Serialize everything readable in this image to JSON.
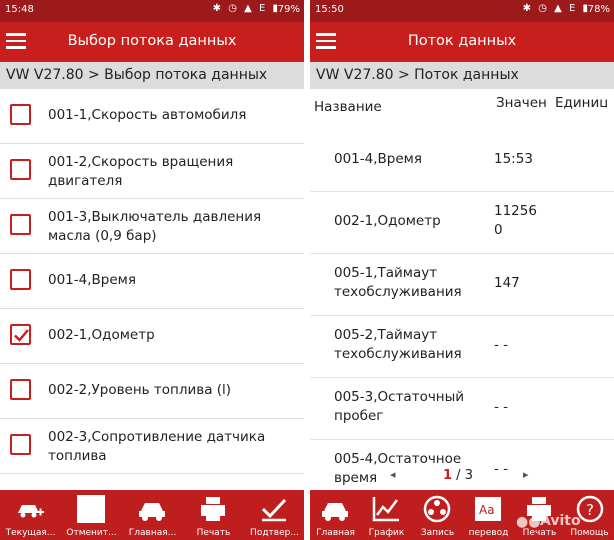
{
  "left": {
    "status": {
      "time": "15:48",
      "battery": "79%",
      "network": "E"
    },
    "appbar": {
      "title": "Выбор потока данных"
    },
    "breadcrumb": "VW V27.80 > Выбор потока данных",
    "items": [
      {
        "label": "001-1,Скорость автомобиля",
        "checked": false
      },
      {
        "label": "001-2,Скорость вращения двигателя",
        "checked": false
      },
      {
        "label": "001-3,Выключатель давления масла (0,9 бар)",
        "checked": false
      },
      {
        "label": "001-4,Время",
        "checked": false
      },
      {
        "label": "002-1,Одометр",
        "checked": true
      },
      {
        "label": "002-2,Уровень топлива (l)",
        "checked": false
      },
      {
        "label": "002-3,Сопротивление датчика топлива",
        "checked": false
      }
    ],
    "bottom": [
      {
        "label": "Текущая...",
        "icon": "car-plus-icon"
      },
      {
        "label": "Отменит...",
        "icon": "checkbox-icon"
      },
      {
        "label": "Главная...",
        "icon": "car-icon"
      },
      {
        "label": "Печать",
        "icon": "printer-icon"
      },
      {
        "label": "Подтвер...",
        "icon": "check-icon"
      }
    ]
  },
  "right": {
    "status": {
      "time": "15:50",
      "battery": "78%",
      "network": "E"
    },
    "appbar": {
      "title": "Поток данных"
    },
    "breadcrumb": "VW V27.80 > Поток данных",
    "columns": {
      "name": "Название",
      "value": "Значение",
      "unit": "Единица"
    },
    "rows": [
      {
        "name": "001-4,Время",
        "value": "15:53"
      },
      {
        "name": "002-1,Одометр",
        "value": "112560"
      },
      {
        "name": "005-1,Таймаут техобслуживания",
        "value": "147"
      },
      {
        "name": "005-2,Таймаут техобслуживания",
        "value": "- -"
      },
      {
        "name": "005-3,Остаточный пробег",
        "value": "- -"
      },
      {
        "name": "005-4,Остаточное время",
        "value": "- -"
      }
    ],
    "pager": {
      "current": "1",
      "separator": " / ",
      "total": "3"
    },
    "bottom": [
      {
        "label": "Главная",
        "icon": "car-icon"
      },
      {
        "label": "График",
        "icon": "chart-icon"
      },
      {
        "label": "Запись",
        "icon": "reel-icon"
      },
      {
        "label": "перевод",
        "icon": "translate-icon"
      },
      {
        "label": "Печать",
        "icon": "printer-icon"
      },
      {
        "label": "Помощь",
        "icon": "help-icon"
      }
    ]
  },
  "watermark": "Avito",
  "colors": {
    "accent": "#c81e1e",
    "statusbar": "#9c1a1a",
    "breadcrumb_bg": "#dcdcdc"
  }
}
